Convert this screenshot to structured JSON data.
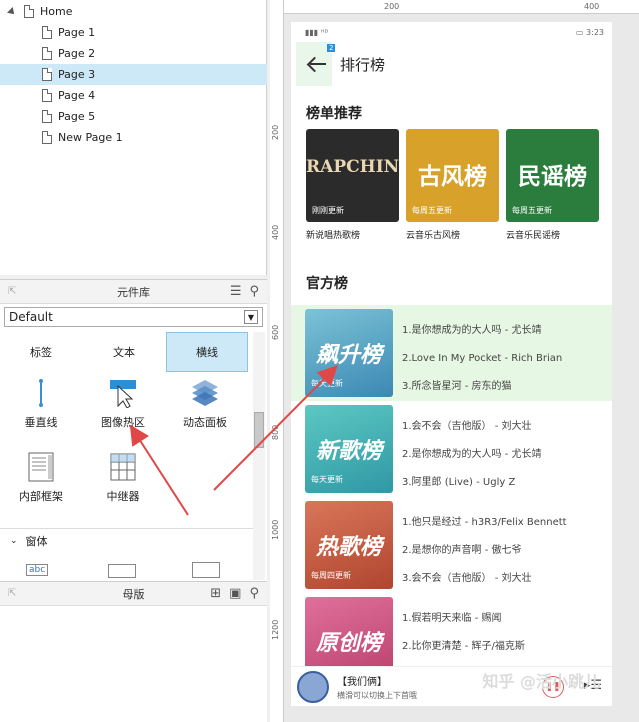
{
  "pages": {
    "home": "Home",
    "items": [
      "Page 1",
      "Page 2",
      "Page 3",
      "Page 4",
      "Page 5",
      "New Page 1"
    ],
    "selected_index": 2
  },
  "library": {
    "title": "元件库",
    "select_value": "Default",
    "tabs": [
      "标签",
      "文本",
      "横线"
    ],
    "widgets": [
      "垂直线",
      "图像热区",
      "动态面板",
      "内部框架",
      "中继器"
    ],
    "section": "窗体"
  },
  "master": {
    "title": "母版"
  },
  "rulers": {
    "top": [
      "200",
      "400"
    ],
    "left": [
      "200",
      "400",
      "600",
      "800",
      "1000",
      "1200"
    ]
  },
  "phone": {
    "time": "3:23",
    "badge": "2",
    "nav_title": "排行榜",
    "section1": "榜单推荐",
    "cards": [
      {
        "cover_text": "RAPCHINA",
        "cover_sub": "刚刚更新",
        "name": "新说唱热歌榜",
        "color": "#2b2b2b"
      },
      {
        "cover_text": "古风榜",
        "cover_sub": "每周五更新",
        "name": "云音乐古风榜",
        "color": "#d8a12a"
      },
      {
        "cover_text": "民谣榜",
        "cover_sub": "每周五更新",
        "name": "云音乐民谣榜",
        "color": "#2a7d3c"
      }
    ],
    "section2": "官方榜",
    "ranks": [
      {
        "cover_text": "飙升榜",
        "cover_sub": "每天更新",
        "color": "#4a9cbf",
        "songs": [
          "1.是你想成为的大人吗 - 尤长靖",
          "2.Love In My Pocket - Rich Brian",
          "3.所念皆星河 - 房东的猫"
        ]
      },
      {
        "cover_text": "新歌榜",
        "cover_sub": "每天更新",
        "color": "#3fb0b3",
        "songs": [
          "1.会不会（吉他版） - 刘大壮",
          "2.是你想成为的大人吗 - 尤长靖",
          "3.阿里郎 (Live) - Ugly Z"
        ]
      },
      {
        "cover_text": "热歌榜",
        "cover_sub": "每周四更新",
        "color": "#c0533d",
        "songs": [
          "1.他只是经过 - h3R3/Felix Bennett",
          "2.是想你的声音啊 - 傲七爷",
          "3.会不会（吉他版） - 刘大壮"
        ]
      },
      {
        "cover_text": "原创榜",
        "cover_sub": "",
        "color": "#cc4f7a",
        "songs": [
          "1.假若明天来临 - 赐闻",
          "2.比你更清楚 - 辉子/福克斯"
        ]
      }
    ],
    "player": {
      "title": "【我们俩】",
      "subtitle": "横滑可以切换上下首哦"
    },
    "watermark": "知乎 @活小跳儿"
  },
  "colors": {
    "accent_green": "#e6f7e3",
    "selection_blue": "#cde8f6",
    "arrow_red": "#e04848"
  }
}
